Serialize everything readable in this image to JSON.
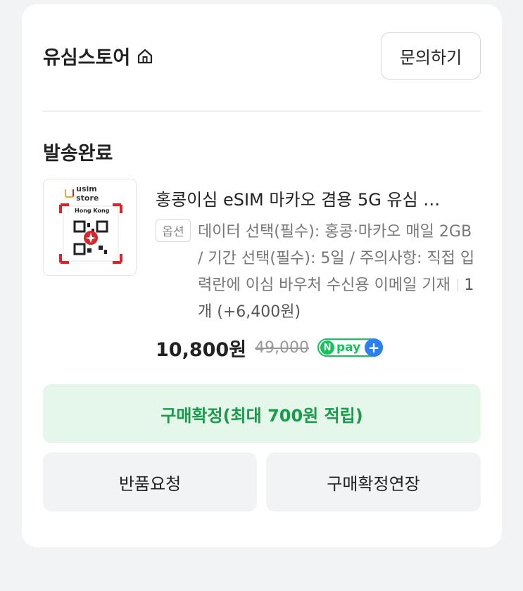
{
  "store": {
    "name": "유심스토어",
    "home_icon": "home-icon",
    "inquiry_label": "문의하기"
  },
  "order": {
    "status": "발송완료",
    "thumbnail": {
      "logo_text": "usim store",
      "region_text": "Hong Kong"
    },
    "product_name": "홍콩이심 eSIM 마카오 겸용 5G 유심 …",
    "option_badge": "옵션",
    "option_text": "데이터 선택(필수): 홍콩·마카오 매일 2GB / 기간 선택(필수): 5일 / 주의사항: 직접 입력란에 이심 바우처 수신용 이메일 기재",
    "quantity": "1개 (+6,400원)",
    "sale_price": "10,800원",
    "original_price": "49,000",
    "npay_label": "pay",
    "npay_n": "N",
    "npay_plus": "+"
  },
  "actions": {
    "confirm_label": "구매확정(최대 700원 적립)",
    "return_label": "반품요청",
    "extend_label": "구매확정연장"
  },
  "colors": {
    "confirm_bg": "#e5f6ea",
    "confirm_text": "#1a9b4b",
    "npay_green": "#12c45b",
    "npay_blue": "#2c7ef5"
  }
}
